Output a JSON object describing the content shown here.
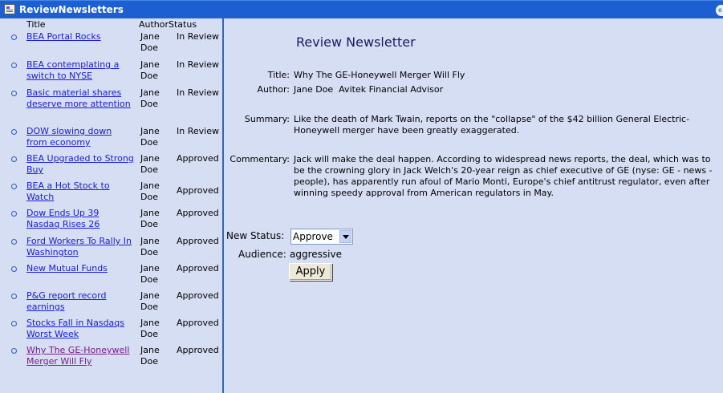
{
  "window": {
    "title": "ReviewNewsletters",
    "corner_button": "e"
  },
  "list": {
    "headers": {
      "title": "Title",
      "author": "Author",
      "status": "Status"
    },
    "rows": [
      {
        "title": "BEA Portal Rocks",
        "author": "Jane Doe",
        "status": "In Review"
      },
      {
        "title": "BEA contemplating a switch to NYSE",
        "author": "Jane Doe",
        "status": "In Review"
      },
      {
        "title": "Basic material shares deserve more attention",
        "author": "Jane Doe",
        "status": "In Review"
      },
      {
        "title": "DOW slowing down from economy",
        "author": "Jane Doe",
        "status": "In Review"
      },
      {
        "title": "BEA Upgraded to Strong Buy",
        "author": "Jane Doe",
        "status": "Approved"
      },
      {
        "title": "BEA a Hot Stock to Watch",
        "author": "Jane Doe",
        "status": "Approved"
      },
      {
        "title": "Dow Ends Up 39 Nasdaq Rises 26",
        "author": "Jane Doe",
        "status": "Approved"
      },
      {
        "title": "Ford Workers To Rally In Washington",
        "author": "Jane Doe",
        "status": "Approved"
      },
      {
        "title": "New Mutual Funds",
        "author": "Jane Doe",
        "status": "Approved"
      },
      {
        "title": "P&G report record earnings",
        "author": "Jane Doe",
        "status": "Approved"
      },
      {
        "title": "Stocks Fall in Nasdaqs Worst Week",
        "author": "Jane Doe",
        "status": "Approved"
      },
      {
        "title": "Why The GE-Honeywell Merger Will Fly",
        "author": "Jane Doe",
        "status": "Approved"
      }
    ]
  },
  "detail": {
    "heading": "Review Newsletter",
    "title_label": "Title:",
    "title_value": "Why The GE-Honeywell Merger Will Fly",
    "author_label": "Author:",
    "author_value": "Jane Doe  Avitek Financial Advisor",
    "summary_label": "Summary:",
    "summary_value": "Like the death of Mark Twain, reports on the \"collapse\" of the $42 billion General Electric-Honeywell merger have been greatly exaggerated.",
    "commentary_label": "Commentary:",
    "commentary_value": "Jack will make the deal happen. According to widespread news reports, the deal, which was to be the crowning glory in Jack Welch's 20-year reign as chief executive of GE (nyse: GE - news - people), has apparently run afoul of Mario Monti, Europe's chief antitrust regulator, even after winning speedy approval from American regulators in May.",
    "new_status_label": "New Status:",
    "new_status_value": "Approve",
    "audience_label": "Audience:",
    "audience_value": "aggressive",
    "apply_label": "Apply"
  },
  "colors": {
    "titlebar": "#1c5fd0",
    "background": "#d6def4",
    "link": "#1b20d6",
    "visited_link": "#7a1a8c"
  }
}
